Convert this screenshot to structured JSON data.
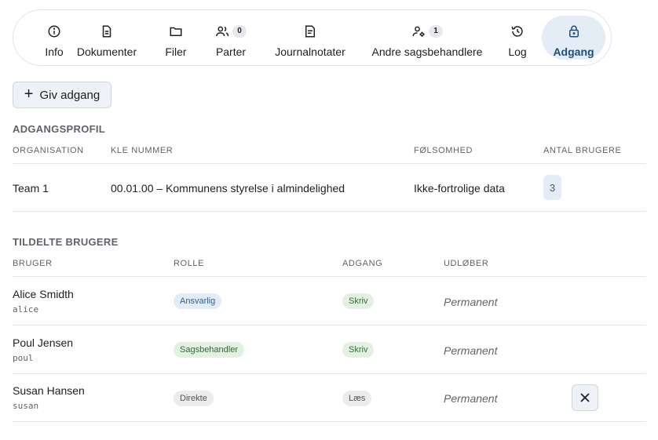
{
  "tabs": [
    {
      "id": "info",
      "label": "Info",
      "icon": "info-icon"
    },
    {
      "id": "dokumenter",
      "label": "Dokumenter",
      "icon": "document-icon"
    },
    {
      "id": "filer",
      "label": "Filer",
      "icon": "folder-icon"
    },
    {
      "id": "parter",
      "label": "Parter",
      "icon": "people-icon",
      "count": "0"
    },
    {
      "id": "journalnotater",
      "label": "Journalnotater",
      "icon": "note-icon"
    },
    {
      "id": "andre",
      "label": "Andre sagsbehandlere",
      "icon": "user-gear-icon",
      "count": "1"
    },
    {
      "id": "log",
      "label": "Log",
      "icon": "history-icon"
    },
    {
      "id": "adgang",
      "label": "Adgang",
      "icon": "lock-icon",
      "active": true
    }
  ],
  "give_access": {
    "label": "Giv adgang",
    "icon": "plus-icon"
  },
  "profile": {
    "title": "ADGANGSPROFIL",
    "headers": {
      "organisation": "ORGANISATION",
      "kle": "KLE NUMMER",
      "sensitivity": "FØLSOMHED",
      "users": "ANTAL BRUGERE"
    },
    "row": {
      "organisation": "Team 1",
      "kle": "00.01.00 – Kommunens styrelse i almindelighed",
      "sensitivity": "Ikke-fortrolige data",
      "users": "3"
    }
  },
  "assigned": {
    "title": "TILDELTE BRUGERE",
    "headers": {
      "user": "BRUGER",
      "role": "ROLLE",
      "access": "ADGANG",
      "expires": "UDLØBER"
    },
    "rows": [
      {
        "name": "Alice Smidth",
        "login": "alice",
        "role": "Ansvarlig",
        "access": "Skriv",
        "expires": "Permanent"
      },
      {
        "name": "Poul Jensen",
        "login": "poul",
        "role": "Sagsbehandler",
        "access": "Skriv",
        "expires": "Permanent"
      },
      {
        "name": "Susan Hansen",
        "login": "susan",
        "role": "Direkte",
        "access": "Læs",
        "expires": "Permanent",
        "removable": true
      }
    ]
  },
  "colors": {
    "accent": "#1f4e7a",
    "active_tab_bg": "#e4ecf5",
    "blue_badge": "#e3ebf5",
    "green_badge": "#e3f1e3",
    "gray_badge": "#ececec"
  }
}
